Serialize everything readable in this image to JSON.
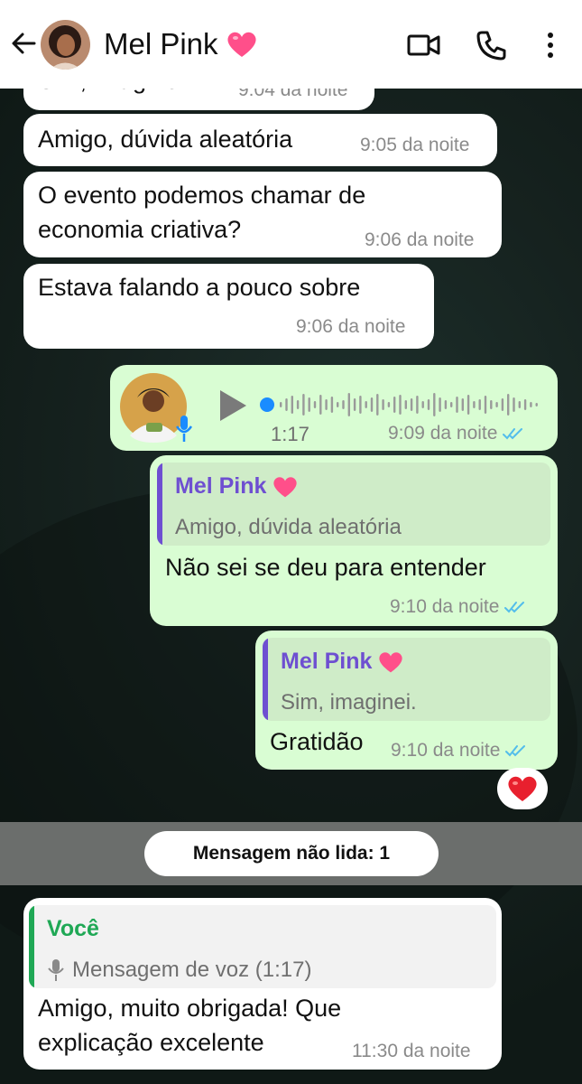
{
  "header": {
    "contact_name": "Mel Pink",
    "contact_emoji": "heart-emoji"
  },
  "messages": [
    {
      "type": "in",
      "text": "Sim, imaginei.",
      "time": "9:04 da noite"
    },
    {
      "type": "in",
      "text": "Amigo, dúvida aleatória",
      "time": "9:05 da noite"
    },
    {
      "type": "in",
      "lines": [
        "O evento podemos chamar de",
        "economia criativa?"
      ],
      "time": "9:06 da noite"
    },
    {
      "type": "in",
      "text": "Estava falando a pouco sobre",
      "time": "9:06 da noite"
    },
    {
      "type": "out-voice",
      "duration": "1:17",
      "time": "9:09 da noite",
      "status": "read"
    },
    {
      "type": "out",
      "quote_name": "Mel Pink",
      "quote_text": "Amigo, dúvida aleatória",
      "text": "Não sei se deu para entender",
      "time": "9:10 da noite",
      "status": "read"
    },
    {
      "type": "out",
      "quote_name": "Mel Pink",
      "quote_text": "Sim, imaginei.",
      "text": "Gratidão",
      "time": "9:10 da noite",
      "status": "read",
      "reaction": "heart"
    },
    {
      "type": "in",
      "quote_name": "Você",
      "quote_text": "Mensagem de voz (1:17)",
      "lines": [
        "Amigo, muito obrigada! Que",
        "explicação excelente"
      ],
      "time": "11:30 da noite"
    }
  ],
  "unread_divider": "Mensagem não lida: 1",
  "colors": {
    "incoming_bubble": "#ffffff",
    "outgoing_bubble": "#d9fdd3",
    "quote_name_purple": "#6e4fd1",
    "quote_name_green": "#1fa855",
    "read_ticks": "#53bdeb",
    "voice_dot": "#1a8cff"
  }
}
